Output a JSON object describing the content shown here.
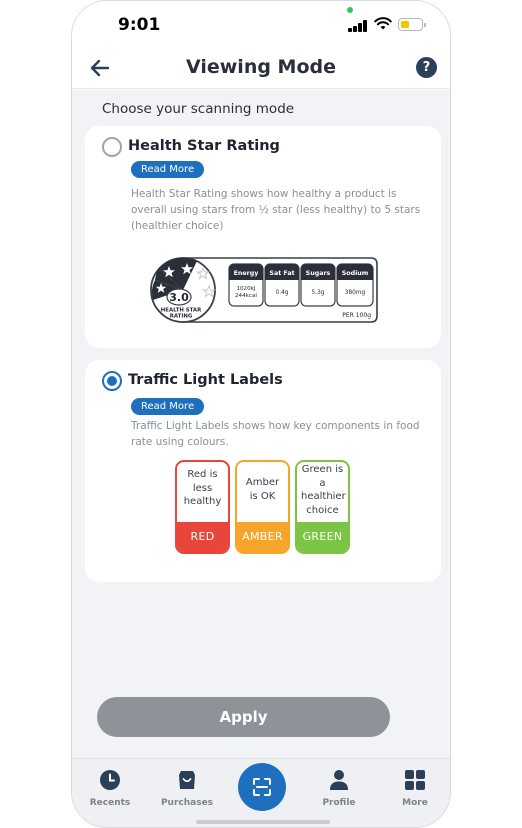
{
  "status_bar": {
    "time": "9:01"
  },
  "header": {
    "title": "Viewing Mode",
    "help_symbol": "?"
  },
  "section_heading": "Choose your scanning mode",
  "options": [
    {
      "title": "Health Star Rating",
      "selected": false,
      "read_more": "Read More",
      "description": "Health Star Rating shows how healthy a product is overall using stars from ½ star (less healthy) to 5 stars (healthier choice)",
      "graphic": {
        "rating": "3.0",
        "rating_caption_line1": "HEALTH STAR",
        "rating_caption_line2": "RATING",
        "nutrients": [
          {
            "name": "Energy",
            "value_line1": "1020kJ",
            "value_line2": "244kcal"
          },
          {
            "name": "Sat Fat",
            "value_line1": "0.4g",
            "value_line2": ""
          },
          {
            "name": "Sugars",
            "value_line1": "5.3g",
            "value_line2": ""
          },
          {
            "name": "Sodium",
            "value_line1": "380mg",
            "value_line2": ""
          }
        ],
        "per": "PER 100g"
      }
    },
    {
      "title": "Traffic Light Labels",
      "selected": true,
      "read_more": "Read More",
      "description": "Traffic Light Labels shows how key components in food rate using colours.",
      "labels": [
        {
          "text": "Red is less healthy",
          "band": "RED",
          "color": "#e8453c"
        },
        {
          "text": "Amber is OK",
          "band": "AMBER",
          "color": "#f6a52a"
        },
        {
          "text": "Green is a healthier choice",
          "band": "GREEN",
          "color": "#7cc443"
        }
      ]
    }
  ],
  "apply_label": "Apply",
  "nav": {
    "recents": "Recents",
    "purchases": "Purchases",
    "profile": "Profile",
    "more": "More"
  },
  "colors": {
    "accent": "#1f6fbf",
    "header_icon": "#2b3f59",
    "apply_disabled": "#8e939a"
  }
}
